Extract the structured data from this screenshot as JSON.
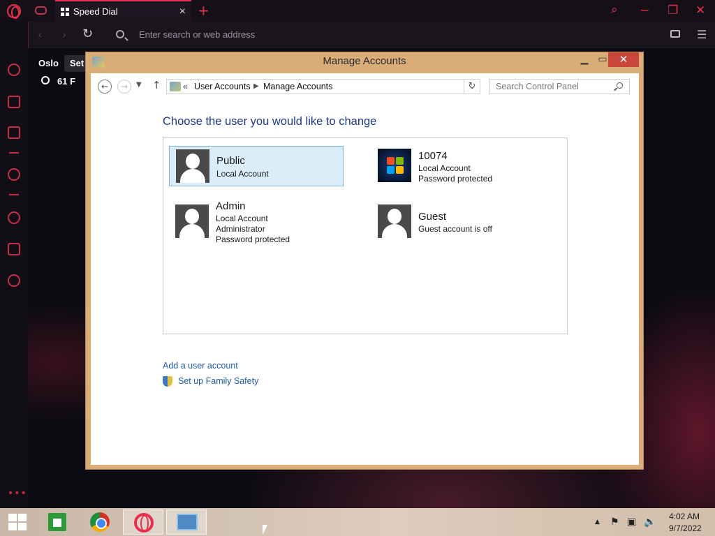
{
  "browser": {
    "tab_title": "Speed Dial",
    "address_placeholder": "Enter search or web address",
    "weather": {
      "city": "Oslo",
      "tooltip": "Set",
      "temp": "61 F"
    }
  },
  "window": {
    "title": "Manage Accounts",
    "breadcrumb": {
      "chevrons": "«",
      "items": [
        "User Accounts",
        "Manage Accounts"
      ]
    },
    "search_placeholder": "Search Control Panel",
    "heading": "Choose the user you would like to change",
    "accounts": [
      {
        "name": "Public",
        "lines": [
          "Local Account"
        ],
        "selected": true,
        "avatar": "generic"
      },
      {
        "name": "10074",
        "lines": [
          "Local Account",
          "Password protected"
        ],
        "selected": false,
        "avatar": "windows-logo"
      },
      {
        "name": "Admin",
        "lines": [
          "Local Account",
          "Administrator",
          "Password protected"
        ],
        "selected": false,
        "avatar": "generic"
      },
      {
        "name": "Guest",
        "lines": [
          "Guest account is off"
        ],
        "selected": false,
        "avatar": "generic"
      }
    ],
    "links": {
      "add_user": "Add a user account",
      "family_safety": "Set up Family Safety"
    }
  },
  "taskbar": {
    "time": "4:02 AM",
    "date": "9/7/2022",
    "pinned": [
      "store-icon",
      "chrome-icon",
      "opera-icon",
      "control-panel-icon"
    ]
  },
  "colors": {
    "accent": "#e8304c",
    "window_frame": "#d9ac78",
    "heading": "#1e3a8a",
    "link": "#1e5ba8"
  }
}
